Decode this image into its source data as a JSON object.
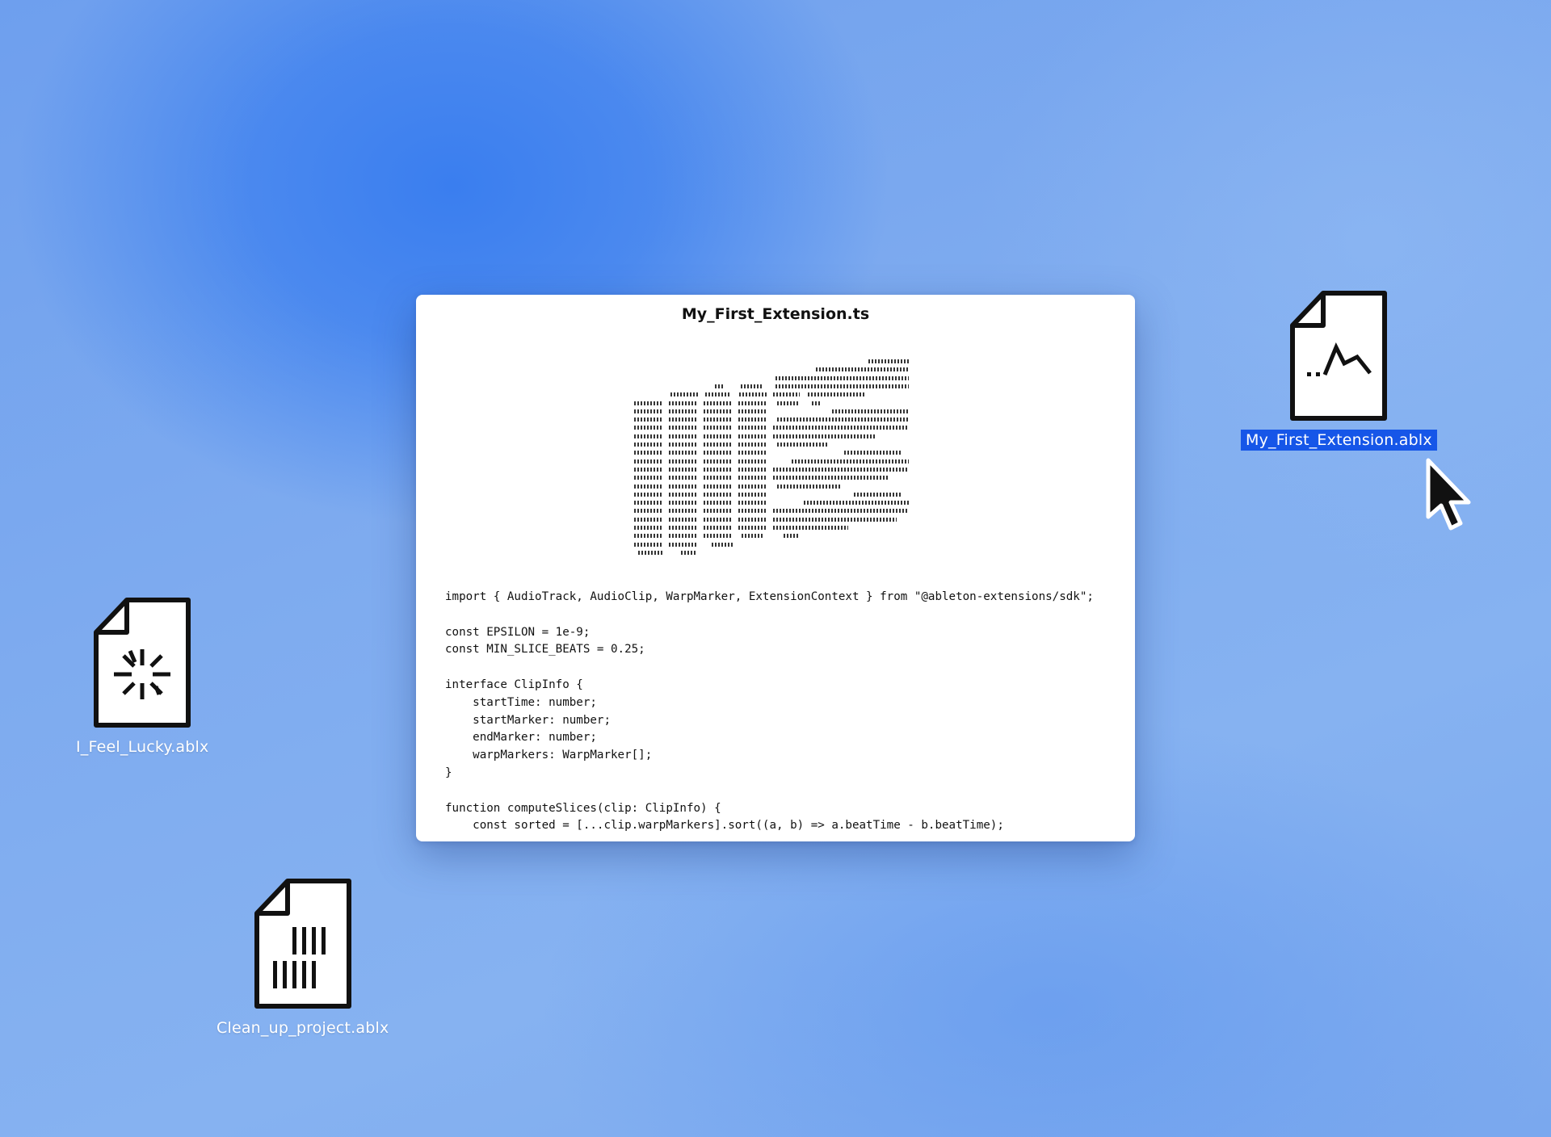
{
  "desktop": {
    "icons": [
      {
        "label": "I_Feel_Lucky.ablx",
        "icon": "sparkle-doc-icon"
      },
      {
        "label": "Clean_up_project.ablx",
        "icon": "barcode-doc-icon"
      },
      {
        "label": "My_First_Extension.ablx",
        "icon": "waveform-doc-icon",
        "selected": true
      }
    ],
    "selection_color": "#1656e8"
  },
  "editor": {
    "title": "My_First_Extension.ts",
    "code_lines": [
      "import { AudioTrack, AudioClip, WarpMarker, ExtensionContext } from \"@ableton-extensions/sdk\";",
      "",
      "const EPSILON = 1e-9;",
      "const MIN_SLICE_BEATS = 0.25;",
      "",
      "interface ClipInfo {",
      "    startTime: number;",
      "    startMarker: number;",
      "    endMarker: number;",
      "    warpMarkers: WarpMarker[];",
      "}",
      "",
      "function computeSlices(clip: ClipInfo) {",
      "    const sorted = [...clip.warpMarkers].sort((a, b) => a.beatTime - b.beatTime);"
    ]
  }
}
